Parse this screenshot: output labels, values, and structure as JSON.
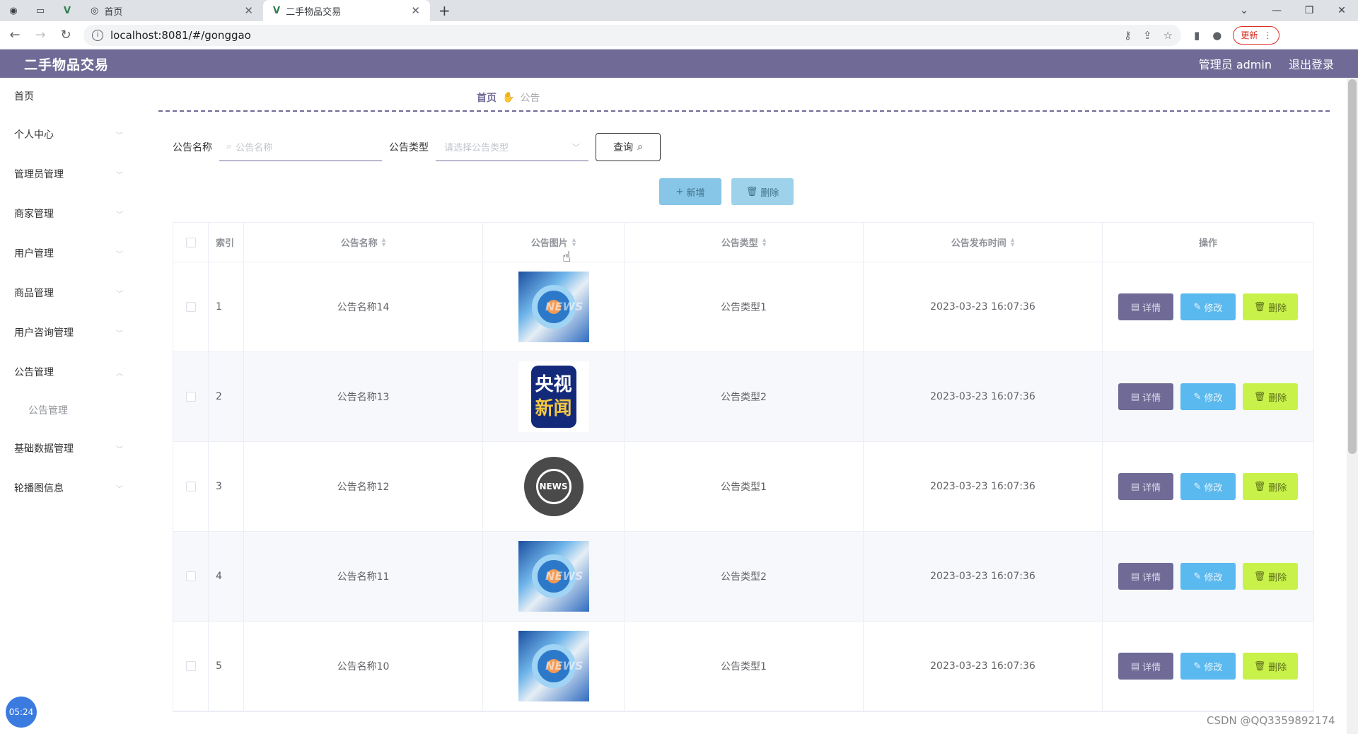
{
  "browser": {
    "tabs": [
      {
        "label": "",
        "icon": "github-icon"
      },
      {
        "label": "",
        "icon": "blank-page-icon"
      },
      {
        "label": "",
        "icon": "vue-icon"
      },
      {
        "label": "首页",
        "icon": "globe-icon"
      },
      {
        "label": "二手物品交易",
        "icon": "vue-icon"
      }
    ],
    "new_tab": "+",
    "url": "localhost:8081/#/gonggao",
    "update_label": "更新"
  },
  "app": {
    "title": "二手物品交易",
    "user_label": "管理员 admin",
    "logout_label": "退出登录"
  },
  "sidebar": {
    "items": [
      {
        "label": "首页"
      },
      {
        "label": "个人中心"
      },
      {
        "label": "管理员管理"
      },
      {
        "label": "商家管理"
      },
      {
        "label": "用户管理"
      },
      {
        "label": "商品管理"
      },
      {
        "label": "用户咨询管理"
      },
      {
        "label": "公告管理"
      },
      {
        "label": "公告管理"
      },
      {
        "label": "基础数据管理"
      },
      {
        "label": "轮播图信息"
      }
    ]
  },
  "breadcrumb": {
    "home": "首页",
    "current": "公告"
  },
  "search": {
    "name_label": "公告名称",
    "name_placeholder": "公告名称",
    "type_label": "公告类型",
    "type_placeholder": "请选择公告类型",
    "query_label": "查询"
  },
  "actions": {
    "add_label": "新增",
    "delete_label": "删除"
  },
  "table": {
    "headers": [
      "索引",
      "公告名称",
      "公告图片",
      "公告类型",
      "公告发布时间",
      "操作"
    ],
    "rows": [
      {
        "index": "1",
        "name": "公告名称14",
        "image": "news-blue",
        "type": "公告类型1",
        "time": "2023-03-23 16:07:36"
      },
      {
        "index": "2",
        "name": "公告名称13",
        "image": "cctv",
        "type": "公告类型2",
        "time": "2023-03-23 16:07:36"
      },
      {
        "index": "3",
        "name": "公告名称12",
        "image": "globe",
        "type": "公告类型1",
        "time": "2023-03-23 16:07:36"
      },
      {
        "index": "4",
        "name": "公告名称11",
        "image": "news-blue",
        "type": "公告类型2",
        "time": "2023-03-23 16:07:36"
      },
      {
        "index": "5",
        "name": "公告名称10",
        "image": "news-blue",
        "type": "公告类型1",
        "time": "2023-03-23 16:07:36"
      }
    ],
    "row_actions": {
      "detail": "详情",
      "edit": "修改",
      "remove": "删除"
    }
  },
  "images": {
    "news_text": "NEWS",
    "cctv_line1": "央视",
    "cctv_line2": "新闻",
    "globe_text": "NEWS"
  },
  "overlay": {
    "timer": "05:24",
    "watermark": "CSDN @QQ3359892174"
  }
}
